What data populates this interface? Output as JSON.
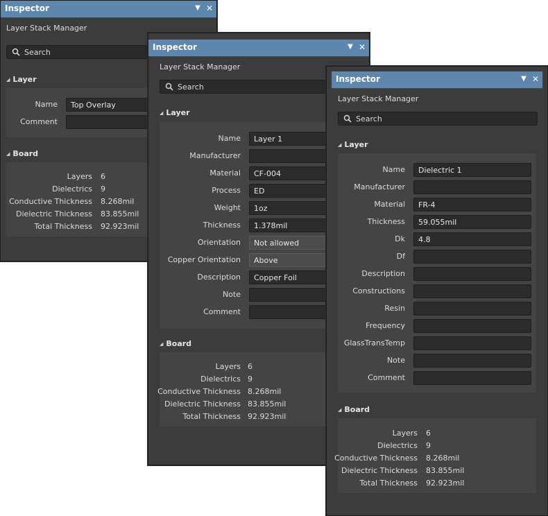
{
  "panel1": {
    "title": "Inspector",
    "subtitle": "Layer Stack Manager",
    "search_placeholder": "Search",
    "layer_section": "Layer",
    "board_section": "Board",
    "fields": [
      {
        "label": "Name",
        "value": "Top Overlay"
      },
      {
        "label": "Comment",
        "value": ""
      }
    ],
    "board": [
      {
        "label": "Layers",
        "value": "6"
      },
      {
        "label": "Dielectrics",
        "value": "9"
      },
      {
        "label": "Conductive Thickness",
        "value": "8.268mil"
      },
      {
        "label": "Dielectric Thickness",
        "value": "83.855mil"
      },
      {
        "label": "Total Thickness",
        "value": "92.923mil"
      }
    ]
  },
  "panel2": {
    "title": "Inspector",
    "subtitle": "Layer Stack Manager",
    "search_placeholder": "Search",
    "layer_section": "Layer",
    "board_section": "Board",
    "fields": [
      {
        "label": "Name",
        "value": "Layer 1"
      },
      {
        "label": "Manufacturer",
        "value": ""
      },
      {
        "label": "Material",
        "value": "CF-004"
      },
      {
        "label": "Process",
        "value": "ED"
      },
      {
        "label": "Weight",
        "value": "1oz"
      },
      {
        "label": "Thickness",
        "value": "1.378mil"
      },
      {
        "label": "Orientation",
        "value": "Not allowed"
      },
      {
        "label": "Copper Orientation",
        "value": "Above"
      },
      {
        "label": "Description",
        "value": "Copper Foil"
      },
      {
        "label": "Note",
        "value": ""
      },
      {
        "label": "Comment",
        "value": ""
      }
    ],
    "board": [
      {
        "label": "Layers",
        "value": "6"
      },
      {
        "label": "Dielectrics",
        "value": "9"
      },
      {
        "label": "Conductive Thickness",
        "value": "8.268mil"
      },
      {
        "label": "Dielectric Thickness",
        "value": "83.855mil"
      },
      {
        "label": "Total Thickness",
        "value": "92.923mil"
      }
    ]
  },
  "panel3": {
    "title": "Inspector",
    "subtitle": "Layer Stack Manager",
    "search_placeholder": "Search",
    "layer_section": "Layer",
    "board_section": "Board",
    "fields": [
      {
        "label": "Name",
        "value": "Dielectric 1"
      },
      {
        "label": "Manufacturer",
        "value": ""
      },
      {
        "label": "Material",
        "value": "FR-4"
      },
      {
        "label": "Thickness",
        "value": "59.055mil"
      },
      {
        "label": "Dk",
        "value": "4.8"
      },
      {
        "label": "Df",
        "value": ""
      },
      {
        "label": "Description",
        "value": ""
      },
      {
        "label": "Constructions",
        "value": ""
      },
      {
        "label": "Resin",
        "value": ""
      },
      {
        "label": "Frequency",
        "value": ""
      },
      {
        "label": "GlassTransTemp",
        "value": ""
      },
      {
        "label": "Note",
        "value": ""
      },
      {
        "label": "Comment",
        "value": ""
      }
    ],
    "board": [
      {
        "label": "Layers",
        "value": "6"
      },
      {
        "label": "Dielectrics",
        "value": "9"
      },
      {
        "label": "Conductive Thickness",
        "value": "8.268mil"
      },
      {
        "label": "Dielectric Thickness",
        "value": "83.855mil"
      },
      {
        "label": "Total Thickness",
        "value": "92.923mil"
      }
    ]
  },
  "icons": {
    "dropdown": "triangle-down-icon",
    "close": "close-icon",
    "search": "magnifier-icon",
    "collapse": "triangle-down-icon"
  },
  "colors": {
    "titlebar": "#5f86ad",
    "panel_bg": "#3c3c3c",
    "group_bg": "#444444",
    "field_bg": "#2b2b2b"
  }
}
